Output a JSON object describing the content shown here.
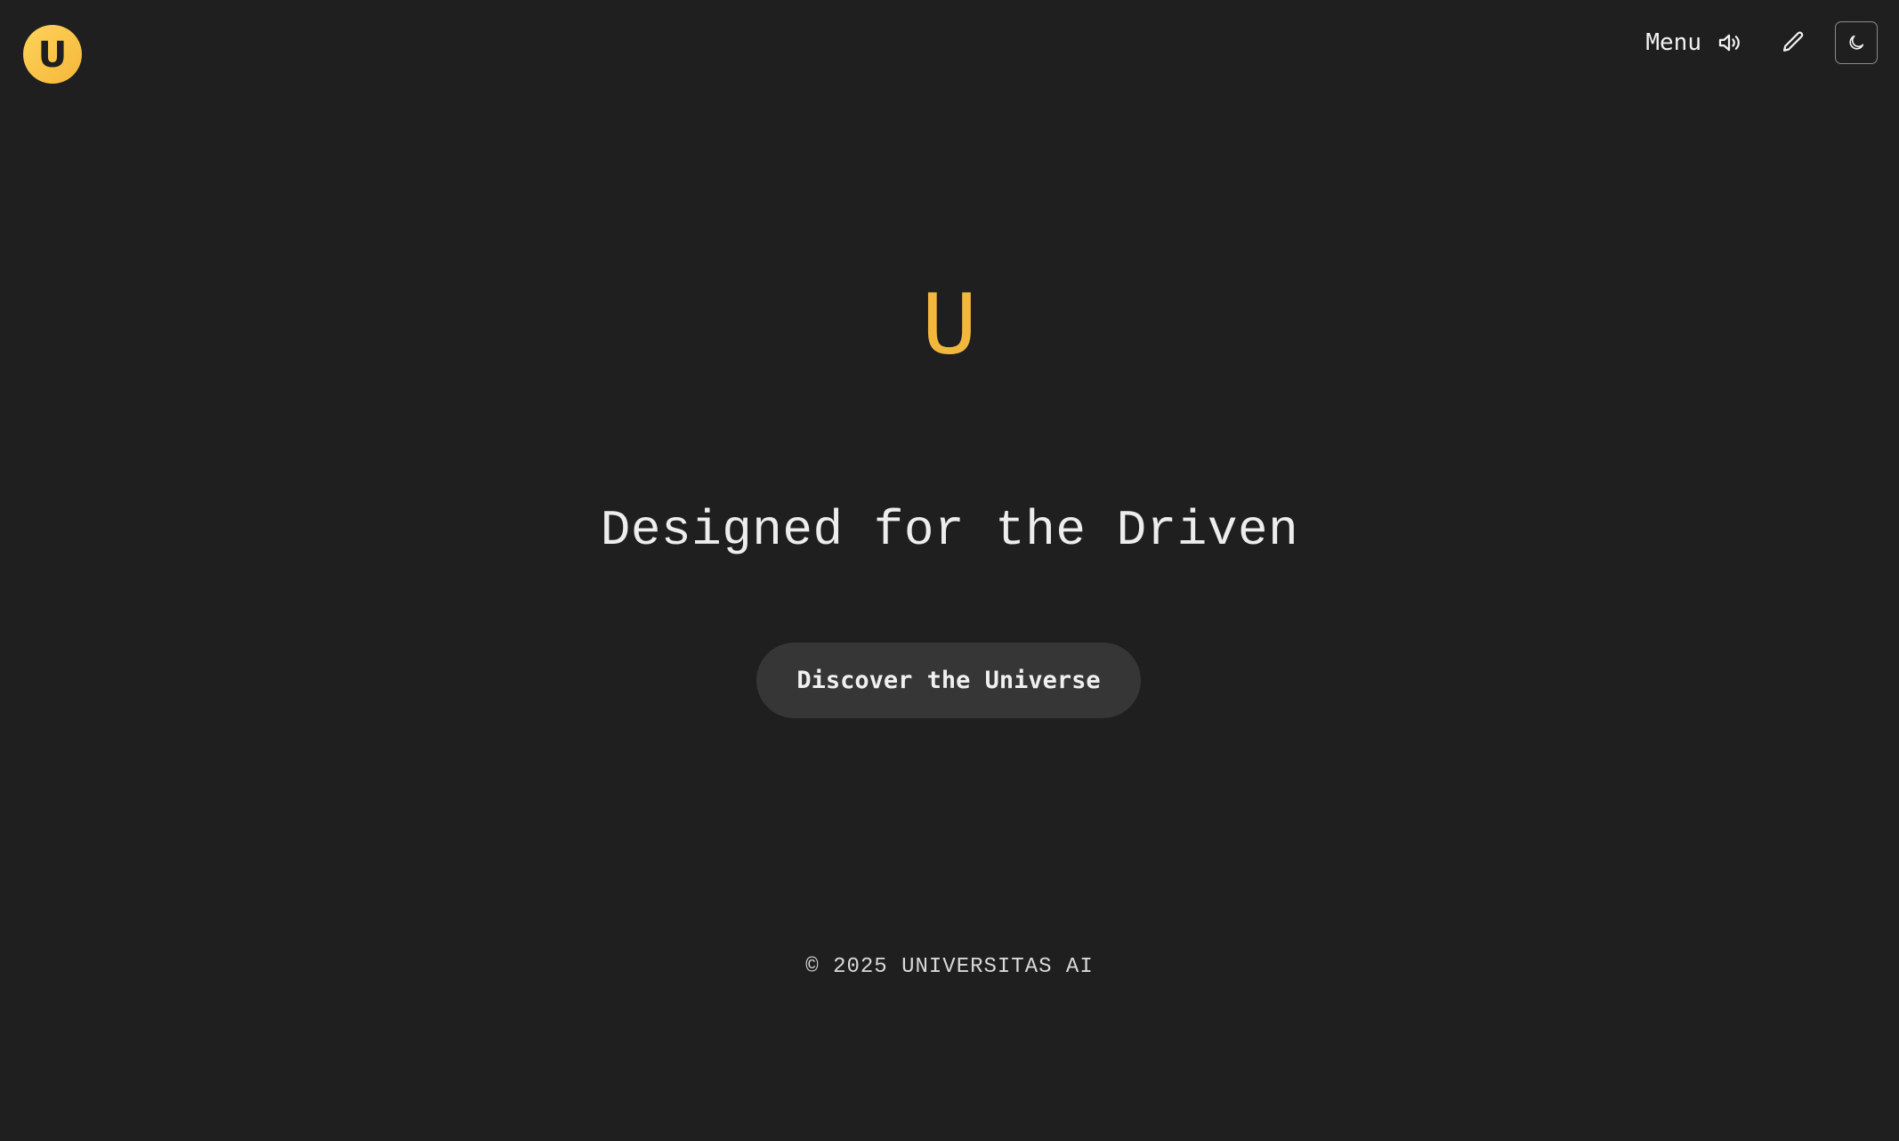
{
  "brand": {
    "badge_letter": "U",
    "accent_color": "#f2b83d"
  },
  "nav": {
    "menu_label": "Menu",
    "icons": [
      "speaker-icon",
      "pencil-icon",
      "moon-icon"
    ]
  },
  "hero": {
    "mark": "U",
    "title": "Designed for the Driven",
    "cta_label": "Discover the Universe"
  },
  "footer": {
    "copyright": "© 2025 UNIVERSITAS AI"
  },
  "colors": {
    "background": "#1f1f1f",
    "button_bg": "#363636",
    "text": "#ededed"
  }
}
